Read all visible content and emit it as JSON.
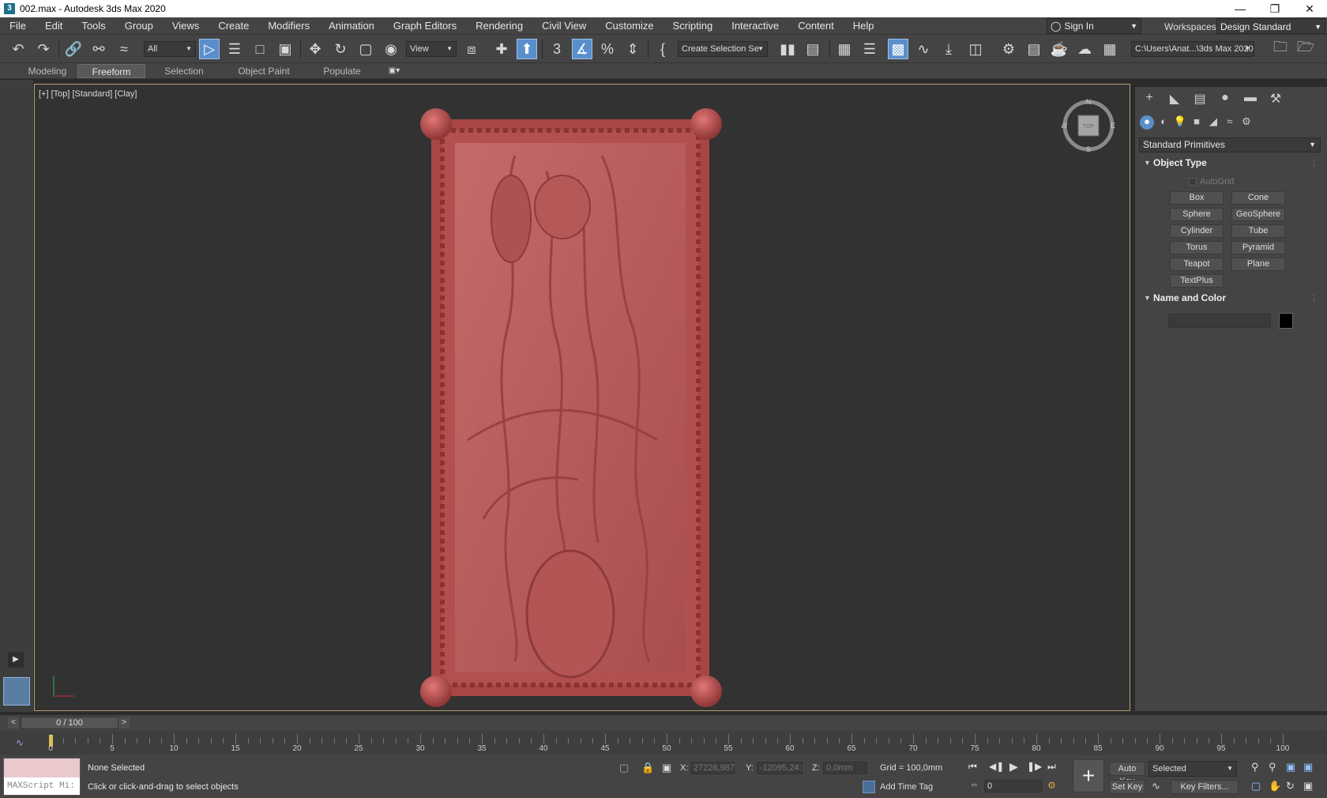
{
  "window": {
    "title": "002.max - Autodesk 3ds Max 2020",
    "app_icon": "3"
  },
  "menubar": {
    "items": [
      "File",
      "Edit",
      "Tools",
      "Group",
      "Views",
      "Create",
      "Modifiers",
      "Animation",
      "Graph Editors",
      "Rendering",
      "Civil View",
      "Customize",
      "Scripting",
      "Interactive",
      "Content",
      "Help"
    ],
    "sign_in": "Sign In",
    "workspaces_label": "Workspaces:",
    "workspace": "Design Standard"
  },
  "toolbar": {
    "filter": "All",
    "ref_coord": "View",
    "selection_set": "Create Selection Se",
    "project_path": "C:\\Users\\Anat...\\3ds Max 2020"
  },
  "ribbon": {
    "tabs": [
      "Modeling",
      "Freeform",
      "Selection",
      "Object Paint",
      "Populate"
    ],
    "active": "Freeform"
  },
  "viewport": {
    "label": "[+] [Top] [Standard] [Clay]",
    "compass": {
      "n": "N",
      "s": "S",
      "e": "E",
      "w": "W",
      "cube_face": "TOP"
    }
  },
  "command_panel": {
    "category": "Standard Primitives",
    "object_type_title": "Object Type",
    "autogrid": "AutoGrid",
    "buttons": [
      "Box",
      "Cone",
      "Sphere",
      "GeoSphere",
      "Cylinder",
      "Tube",
      "Torus",
      "Pyramid",
      "Teapot",
      "Plane",
      "TextPlus"
    ],
    "name_color_title": "Name and Color",
    "swatch_color": "#000000"
  },
  "timeline": {
    "frame": "0 / 100",
    "prev": "<",
    "next": ">",
    "ticks": [
      "0",
      "5",
      "10",
      "15",
      "20",
      "25",
      "30",
      "35",
      "40",
      "45",
      "50",
      "55",
      "60",
      "65",
      "70",
      "75",
      "80",
      "85",
      "90",
      "95",
      "100"
    ]
  },
  "status": {
    "maxscript_placeholder": "MAXScript Mi:",
    "selection": "None Selected",
    "prompt": "Click or click-and-drag to select objects",
    "x_label": "X:",
    "x_value": "27226,987",
    "y_label": "Y:",
    "y_value": "-12095,24:",
    "z_label": "Z:",
    "z_value": "0,0mm",
    "grid": "Grid = 100,0mm",
    "add_time_tag": "Add Time Tag",
    "auto_key": "Auto Key",
    "set_key": "Set Key",
    "key_mode": "Selected",
    "key_filters": "Key Filters...",
    "current_frame": "0"
  }
}
